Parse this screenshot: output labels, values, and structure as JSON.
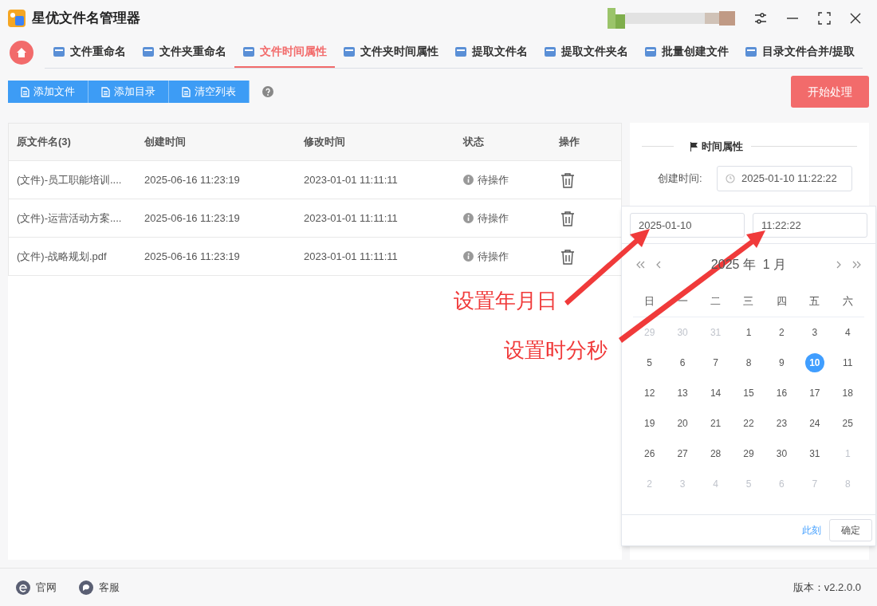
{
  "window": {
    "title": "星优文件名管理器"
  },
  "tabs": [
    {
      "label": "文件重命名",
      "selected": false
    },
    {
      "label": "文件夹重命名",
      "selected": false
    },
    {
      "label": "文件时间属性",
      "selected": true
    },
    {
      "label": "文件夹时间属性",
      "selected": false
    },
    {
      "label": "提取文件名",
      "selected": false
    },
    {
      "label": "提取文件夹名",
      "selected": false
    },
    {
      "label": "批量创建文件",
      "selected": false
    },
    {
      "label": "目录文件合并/提取",
      "selected": false
    }
  ],
  "toolbar": {
    "buttons": [
      "添加文件",
      "添加目录",
      "清空列表"
    ],
    "start_button": "开始处理"
  },
  "table": {
    "columns": [
      "原文件名(3)",
      "创建时间",
      "修改时间",
      "状态",
      "操作"
    ],
    "rows": [
      {
        "name": "(文件)-员工职能培训....",
        "created": "2025-06-16 11:23:19",
        "modified": "2023-01-01 11:11:11",
        "status": "待操作"
      },
      {
        "name": "(文件)-运营活动方案....",
        "created": "2025-06-16 11:23:19",
        "modified": "2023-01-01 11:11:11",
        "status": "待操作"
      },
      {
        "name": "(文件)-战略规划.pdf",
        "created": "2025-06-16 11:23:19",
        "modified": "2023-01-01 11:11:11",
        "status": "待操作"
      }
    ]
  },
  "panel": {
    "heading": "时间属性",
    "fields": [
      {
        "label": "创建时间:",
        "value": "2025-01-10 11:22:22"
      }
    ]
  },
  "date_picker": {
    "date_value": "2025-01-10",
    "time_value": "11:22:22",
    "header": "2025 年  1 月",
    "weekdays": [
      "日",
      "一",
      "二",
      "三",
      "四",
      "五",
      "六"
    ],
    "weeks": [
      [
        {
          "label": "29",
          "outside": true,
          "selected": false
        },
        {
          "label": "30",
          "outside": true,
          "selected": false
        },
        {
          "label": "31",
          "outside": true,
          "selected": false
        },
        {
          "label": "1",
          "outside": false,
          "selected": false
        },
        {
          "label": "2",
          "outside": false,
          "selected": false
        },
        {
          "label": "3",
          "outside": false,
          "selected": false
        },
        {
          "label": "4",
          "outside": false,
          "selected": false
        }
      ],
      [
        {
          "label": "5",
          "outside": false,
          "selected": false
        },
        {
          "label": "6",
          "outside": false,
          "selected": false
        },
        {
          "label": "7",
          "outside": false,
          "selected": false
        },
        {
          "label": "8",
          "outside": false,
          "selected": false
        },
        {
          "label": "9",
          "outside": false,
          "selected": false
        },
        {
          "label": "10",
          "outside": false,
          "selected": true
        },
        {
          "label": "11",
          "outside": false,
          "selected": false
        }
      ],
      [
        {
          "label": "12",
          "outside": false,
          "selected": false
        },
        {
          "label": "13",
          "outside": false,
          "selected": false
        },
        {
          "label": "14",
          "outside": false,
          "selected": false
        },
        {
          "label": "15",
          "outside": false,
          "selected": false
        },
        {
          "label": "16",
          "outside": false,
          "selected": false
        },
        {
          "label": "17",
          "outside": false,
          "selected": false
        },
        {
          "label": "18",
          "outside": false,
          "selected": false
        }
      ],
      [
        {
          "label": "19",
          "outside": false,
          "selected": false
        },
        {
          "label": "20",
          "outside": false,
          "selected": false
        },
        {
          "label": "21",
          "outside": false,
          "selected": false
        },
        {
          "label": "22",
          "outside": false,
          "selected": false
        },
        {
          "label": "23",
          "outside": false,
          "selected": false
        },
        {
          "label": "24",
          "outside": false,
          "selected": false
        },
        {
          "label": "25",
          "outside": false,
          "selected": false
        }
      ],
      [
        {
          "label": "26",
          "outside": false,
          "selected": false
        },
        {
          "label": "27",
          "outside": false,
          "selected": false
        },
        {
          "label": "28",
          "outside": false,
          "selected": false
        },
        {
          "label": "29",
          "outside": false,
          "selected": false
        },
        {
          "label": "30",
          "outside": false,
          "selected": false
        },
        {
          "label": "31",
          "outside": false,
          "selected": false
        },
        {
          "label": "1",
          "outside": true,
          "selected": false
        }
      ],
      [
        {
          "label": "2",
          "outside": true,
          "selected": false
        },
        {
          "label": "3",
          "outside": true,
          "selected": false
        },
        {
          "label": "4",
          "outside": true,
          "selected": false
        },
        {
          "label": "5",
          "outside": true,
          "selected": false
        },
        {
          "label": "6",
          "outside": true,
          "selected": false
        },
        {
          "label": "7",
          "outside": true,
          "selected": false
        },
        {
          "label": "8",
          "outside": true,
          "selected": false
        }
      ]
    ],
    "now_link": "此刻",
    "confirm_button": "确定"
  },
  "annotations": [
    "设置年月日",
    "设置时分秒"
  ],
  "footer": {
    "links": [
      "官网",
      "客服"
    ],
    "version": "版本：v2.2.0.0"
  }
}
